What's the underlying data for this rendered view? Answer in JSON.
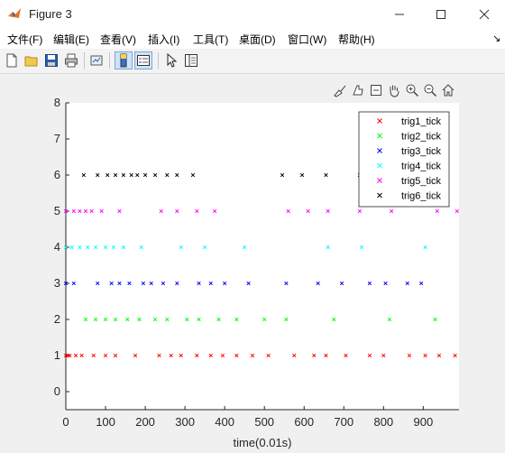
{
  "window": {
    "title": "Figure 3"
  },
  "menu": [
    "文件(F)",
    "编辑(E)",
    "查看(V)",
    "插入(I)",
    "工具(T)",
    "桌面(D)",
    "窗口(W)",
    "帮助(H)"
  ],
  "toolbar": [
    {
      "icon": "new-figure-icon"
    },
    {
      "icon": "open-file-icon"
    },
    {
      "icon": "save-icon"
    },
    {
      "icon": "print-icon"
    },
    {
      "icon": "link-plot-icon"
    },
    {
      "icon": "colorbar-icon"
    },
    {
      "icon": "legend-icon"
    },
    {
      "icon": "edit-plot-icon"
    },
    {
      "icon": "property-inspector-icon"
    }
  ],
  "axes_toolbar": [
    {
      "icon": "brush-icon"
    },
    {
      "icon": "data-tip-icon"
    },
    {
      "icon": "export-icon"
    },
    {
      "icon": "pan-icon"
    },
    {
      "icon": "zoom-in-icon"
    },
    {
      "icon": "zoom-out-icon"
    },
    {
      "icon": "home-icon"
    }
  ],
  "chart_data": {
    "type": "scatter",
    "xlabel": "time(0.01s)",
    "ylabel": "",
    "xlim": [
      0,
      990
    ],
    "ylim": [
      -0.5,
      8
    ],
    "xticks": [
      0,
      100,
      200,
      300,
      400,
      500,
      600,
      700,
      800,
      900
    ],
    "yticks": [
      0,
      1,
      2,
      3,
      4,
      5,
      6,
      7,
      8
    ],
    "marker": "x",
    "grid": false,
    "legend_position": "top-right",
    "series": [
      {
        "name": "trig1_tick",
        "color": "#ff0000",
        "y": 1,
        "x": [
          0,
          5,
          10,
          25,
          40,
          70,
          100,
          125,
          175,
          235,
          265,
          290,
          330,
          365,
          395,
          430,
          470,
          510,
          575,
          625,
          655,
          705,
          765,
          800,
          865,
          905,
          940,
          980
        ]
      },
      {
        "name": "trig2_tick",
        "color": "#00ff00",
        "y": 2,
        "x": [
          50,
          75,
          100,
          125,
          155,
          185,
          225,
          255,
          305,
          335,
          385,
          430,
          500,
          555,
          675,
          815,
          930
        ]
      },
      {
        "name": "trig3_tick",
        "color": "#0000ff",
        "y": 3,
        "x": [
          0,
          20,
          80,
          115,
          135,
          160,
          195,
          215,
          245,
          280,
          335,
          365,
          400,
          460,
          555,
          635,
          695,
          765,
          805,
          860,
          895
        ]
      },
      {
        "name": "trig4_tick",
        "color": "#00ffff",
        "y": 4,
        "x": [
          0,
          15,
          35,
          55,
          75,
          100,
          120,
          145,
          190,
          290,
          350,
          450,
          660,
          745,
          905
        ]
      },
      {
        "name": "trig5_tick",
        "color": "#ff00ff",
        "y": 5,
        "x": [
          0,
          20,
          35,
          50,
          65,
          90,
          135,
          240,
          280,
          330,
          375,
          560,
          610,
          660,
          740,
          820,
          935,
          985
        ]
      },
      {
        "name": "trig6_tick",
        "color": "#000000",
        "y": 6,
        "x": [
          45,
          80,
          105,
          125,
          145,
          165,
          180,
          200,
          225,
          255,
          280,
          320,
          545,
          595,
          655,
          740
        ]
      }
    ]
  }
}
